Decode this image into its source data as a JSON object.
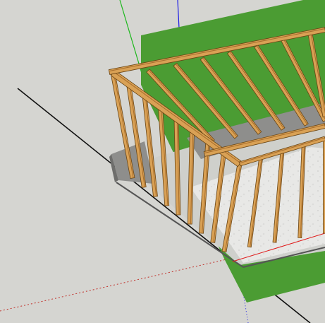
{
  "scene": {
    "colors": {
      "background": "#d5d5d1",
      "grass": "#4b9c33",
      "grass_dark": "#3f8a2b",
      "slab": "#cfd0cc",
      "slab_shadow": "#b9bab6",
      "concrete": "#e9e9e7",
      "wall_face": "#8e8e8c",
      "wood": "#d9a155",
      "wood_shade": "#a76d2c",
      "wood_edge": "#6a4514",
      "axis_green": "#1db81d",
      "axis_blue": "#1a1ae6",
      "axis_red": "#e01a1a",
      "axis_dotted": "#c0302a",
      "guide_line": "#111111"
    },
    "objects": {
      "grass_plot": "grass-pad",
      "floor_slab": "concrete-slab",
      "wall_frame": "stud-wall-frame",
      "roof_rafters": "rafter-frame"
    }
  }
}
